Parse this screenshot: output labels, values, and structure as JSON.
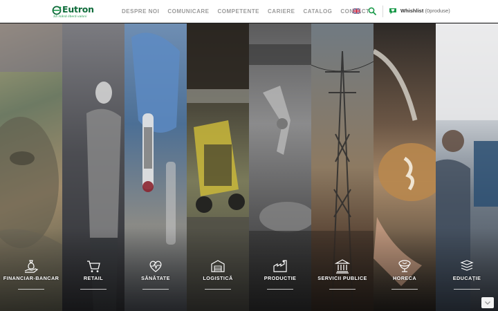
{
  "brand": {
    "name": "Eutron",
    "tagline": "Să mână liberă valorii",
    "colors": {
      "primary": "#0e6b3a",
      "accent": "#1a9a4a"
    }
  },
  "nav": {
    "items": [
      {
        "label": "DESPRE NOI"
      },
      {
        "label": "COMUNICARE"
      },
      {
        "label": "COMPETENTE"
      },
      {
        "label": "CARIERE"
      },
      {
        "label": "CATALOG"
      },
      {
        "label": "CONTACT"
      }
    ],
    "language_icon": "uk-flag-icon",
    "search_icon": "search-icon"
  },
  "wishlist": {
    "label": "Whishlist",
    "count_text": "(0produse)",
    "icon": "heart-chat-icon"
  },
  "sectors": [
    {
      "label": "FINANCIAR-BANCAR",
      "icon": "money-bag-hand-icon",
      "color": "#8b8a73"
    },
    {
      "label": "RETAIL",
      "icon": "shopping-cart-icon",
      "color": "#5f5f62"
    },
    {
      "label": "SĂNĂTATE",
      "icon": "heart-pulse-icon",
      "color": "#5b7fa8"
    },
    {
      "label": "LOGISTICĂ",
      "icon": "warehouse-icon",
      "color": "#6d6a3c"
    },
    {
      "label": "PRODUCTIE",
      "icon": "factory-icon",
      "color": "#6f6f70"
    },
    {
      "label": "SERVICII PUBLICE",
      "icon": "public-building-icon",
      "color": "#6b5a45"
    },
    {
      "label": "HORECA",
      "icon": "coffee-cup-icon",
      "color": "#8a6a4a"
    },
    {
      "label": "EDUCAȚIE",
      "icon": "books-stack-icon",
      "color": "#5a6069"
    }
  ]
}
